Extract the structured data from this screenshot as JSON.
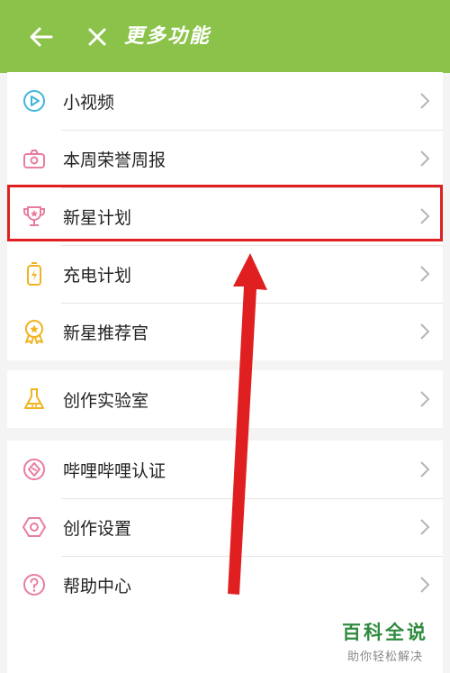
{
  "header": {
    "title": "更多功能",
    "background": "#8bc34a",
    "back_icon": "arrow-left-icon",
    "close_icon": "close-icon"
  },
  "groups": [
    {
      "items": [
        {
          "label": "小视频",
          "icon": "play-circle-icon",
          "icon_color": "#3fb6d9"
        },
        {
          "label": "本周荣誉周报",
          "icon": "camera-icon",
          "icon_color": "#e87d9e"
        },
        {
          "label": "新星计划",
          "icon": "trophy-icon",
          "icon_color": "#e87d9e",
          "highlighted": true
        },
        {
          "label": "充电计划",
          "icon": "battery-charge-icon",
          "icon_color": "#f0b420"
        },
        {
          "label": "新星推荐官",
          "icon": "award-medal-icon",
          "icon_color": "#f0b420"
        }
      ]
    },
    {
      "items": [
        {
          "label": "创作实验室",
          "icon": "flask-icon",
          "icon_color": "#f0b420"
        }
      ]
    },
    {
      "items": [
        {
          "label": "哔哩哔哩认证",
          "icon": "certified-badge-icon",
          "icon_color": "#e87d9e"
        },
        {
          "label": "创作设置",
          "icon": "settings-hexagon-icon",
          "icon_color": "#e87d9e"
        },
        {
          "label": "帮助中心",
          "icon": "help-circle-icon",
          "icon_color": "#e87d9e"
        }
      ]
    }
  ],
  "annotation": {
    "color": "#e02020"
  },
  "watermark": {
    "brand": "百科全说",
    "slogan": "助你轻松解决",
    "color": "#2e8b3e"
  }
}
